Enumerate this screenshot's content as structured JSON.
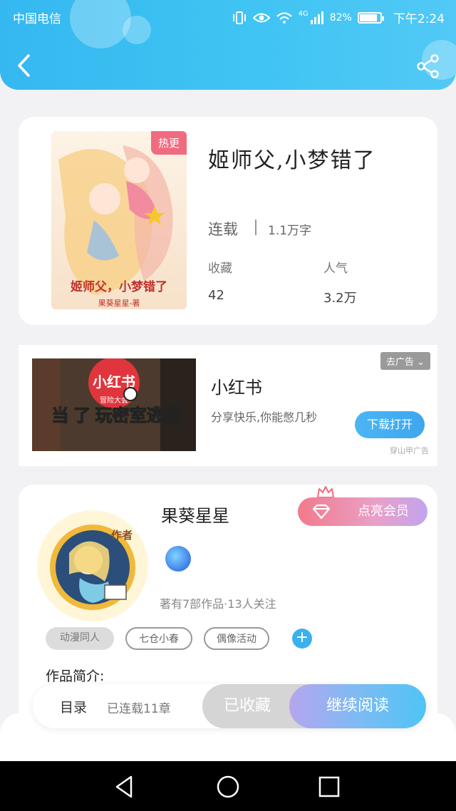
{
  "status_bar": {
    "carrier": "中国电信",
    "network": "4G",
    "battery": "82%",
    "time": "下午2:24"
  },
  "book": {
    "title": "姬师父,小梦错了",
    "hot_badge": "热更",
    "status": "连载",
    "word_count": "1.1万字",
    "collect_label": "收藏",
    "collect_value": "42",
    "popularity_label": "人气",
    "popularity_value": "3.2万",
    "cover_text": "姬师父，小梦错了",
    "cover_author": "果葵星星-著"
  },
  "ad": {
    "close_label": "去广告",
    "title": "小红书",
    "description": "分享快乐,你能憋几秒",
    "download_label": "下载打开",
    "source": "穿山甲广告",
    "image_logo": "小红书",
    "image_text": "当  了 玩密室逃脱",
    "image_subtext": "冒险大会"
  },
  "author": {
    "name": "果葵星星",
    "vip_label": "点亮会员",
    "avatar_badge": "作者",
    "works_info": "著有7部作品·13人关注",
    "tags": [
      "动漫同人",
      "七仓小春",
      "偶像活动"
    ],
    "intro_label": "作品简介:"
  },
  "bottom_bar": {
    "catalog_label": "目录",
    "catalog_progress": "已连载11章",
    "collected_label": "已收藏",
    "continue_label": "继续阅读"
  },
  "colors": {
    "header": "#3fc4f3",
    "accent_blue": "#39b1ef",
    "hot_badge": "#f06b7f",
    "vip_pink": "#f27a8a"
  },
  "icons": [
    "back-icon",
    "share-icon",
    "vibrate-icon",
    "eye-icon",
    "wifi-icon",
    "signal-icon",
    "battery-icon",
    "diamond-icon",
    "crown-icon",
    "plus-icon",
    "nav-back-icon",
    "nav-home-icon",
    "nav-recent-icon"
  ]
}
